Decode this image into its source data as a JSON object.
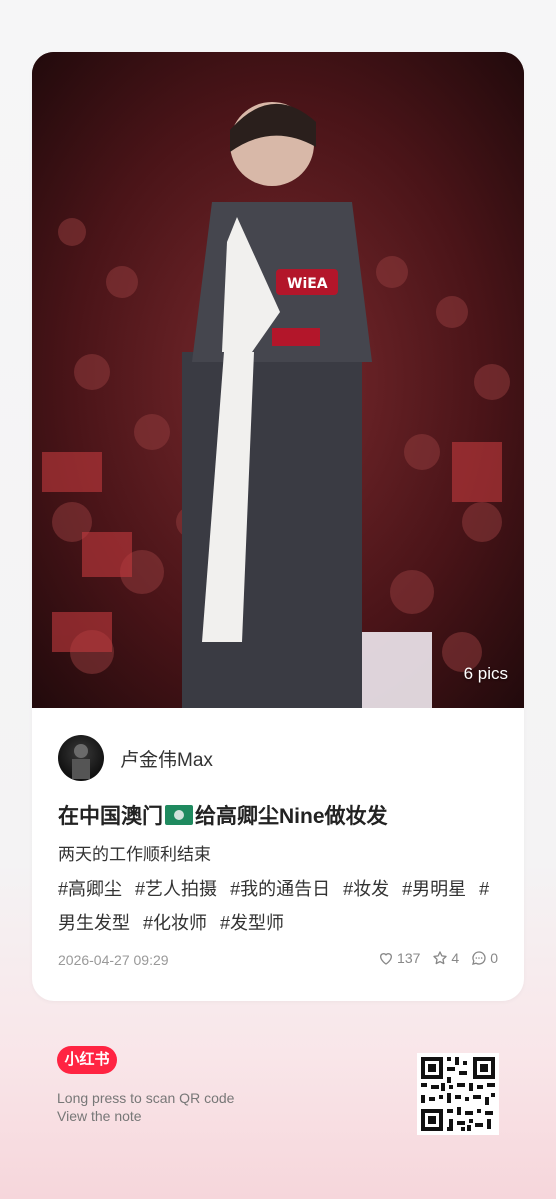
{
  "photo": {
    "pics_label": "6 pics"
  },
  "author": {
    "name": "卢金伟Max"
  },
  "post": {
    "title_prefix": "在中国澳门",
    "title_suffix": "给高卿尘Nine做妆发",
    "description": "两天的工作顺利结束",
    "tags": [
      "#高卿尘",
      "#艺人拍摄",
      "#我的通告日",
      "#妆发",
      "#男明星",
      "#男生发型",
      "#化妆师",
      "#发型师"
    ],
    "timestamp": "2026-04-27 09:29",
    "likes": "137",
    "collects": "4",
    "comments": "0"
  },
  "footer": {
    "brand": "小红书",
    "scan_line1": "Long press to scan QR code",
    "scan_line2": "View the note"
  },
  "colors": {
    "brand": "#ff2442",
    "flag": "#1f8a5f"
  },
  "icons": [
    "heart-icon",
    "star-icon",
    "comment-icon",
    "macau-flag-icon",
    "qr-code"
  ]
}
